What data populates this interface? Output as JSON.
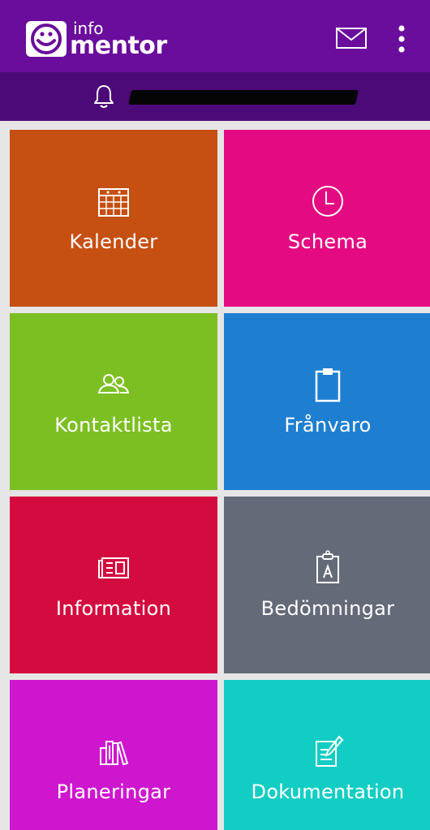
{
  "header": {
    "logo_small": "info",
    "logo_big": "mentor",
    "bar_color": "#6a0d9c",
    "icons": [
      "mail-icon",
      "more-vertical-icon"
    ]
  },
  "notification_bar": {
    "bar_color": "#4b0a78",
    "icon": "bell-icon"
  },
  "tiles": [
    {
      "label": "Kalender",
      "color": "#c64f12",
      "icon": "calendar-icon"
    },
    {
      "label": "Schema",
      "color": "#e40b82",
      "icon": "clock-icon"
    },
    {
      "label": "Kontaktlista",
      "color": "#7cbf22",
      "icon": "contacts-icon"
    },
    {
      "label": "Frånvaro",
      "color": "#1e7fd1",
      "icon": "clipboard-icon"
    },
    {
      "label": "Information",
      "color": "#d40b3f",
      "icon": "newspaper-icon"
    },
    {
      "label": "Bedömningar",
      "color": "#646a78",
      "icon": "assessment-clipboard-icon"
    },
    {
      "label": "Planeringar",
      "color": "#ce16ce",
      "icon": "books-icon"
    },
    {
      "label": "Dokumentation",
      "color": "#12cdc3",
      "icon": "document-edit-icon"
    }
  ]
}
